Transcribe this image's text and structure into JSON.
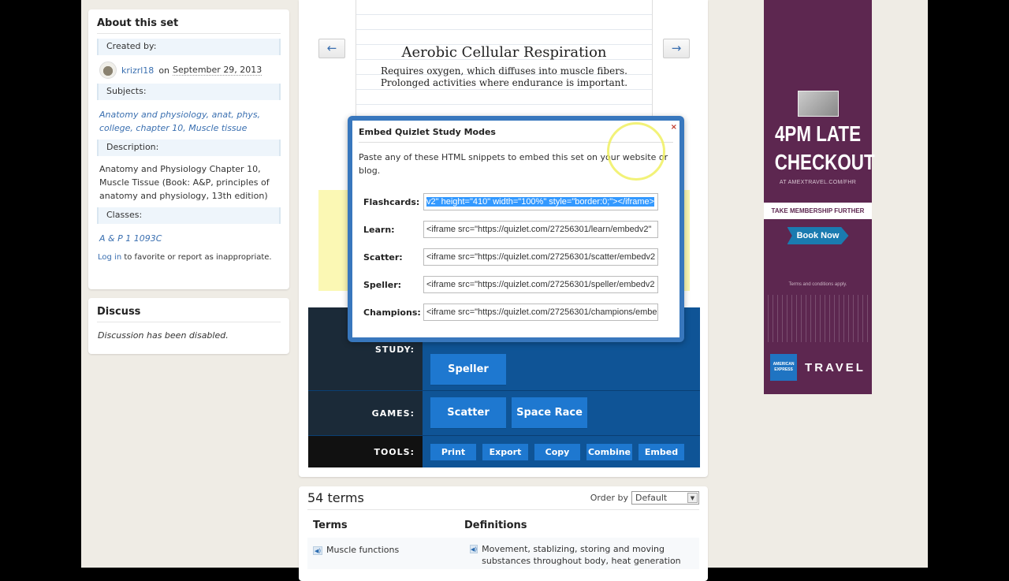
{
  "about": {
    "title": "About this set",
    "created_label": "Created by:",
    "author": "krizrl18",
    "on": "on",
    "date": "September 29, 2013",
    "subjects_label": "Subjects:",
    "subjects": [
      "Anatomy and physiology",
      "anat",
      "phys",
      "college",
      "chapter 10",
      "Muscle tissue"
    ],
    "description_label": "Description:",
    "description": "Anatomy and Physiology Chapter 10, Muscle Tissue (Book: A&P, principles of anatomy and physiology, 13th edition)",
    "classes_label": "Classes:",
    "class": "A & P 1 1093C",
    "login": "Log in",
    "login_rest": "to favorite or report as inappropriate."
  },
  "discuss": {
    "title": "Discuss",
    "text": "Discussion has been disabled."
  },
  "flashcard": {
    "term": "Aerobic Cellular Respiration",
    "definition_line1": "Requires oxygen, which diffuses into muscle fibers.",
    "definition_line2": "Prolonged activities where endurance is important.",
    "prev": "←",
    "next": "→"
  },
  "modes": {
    "study_label": "STUDY:",
    "study": [
      "Speller"
    ],
    "games_label": "GAMES:",
    "games": [
      "Scatter",
      "Space Race"
    ],
    "tools_label": "TOOLS:",
    "tools": [
      "Print",
      "Export",
      "Copy",
      "Combine",
      "Embed"
    ]
  },
  "terms": {
    "count": "54 terms",
    "order_label": "Order by",
    "order_value": "Default",
    "col_terms": "Terms",
    "col_defs": "Definitions",
    "rows": [
      {
        "term": "Muscle functions",
        "definition": "Movement, stablizing, storing and moving substances throughout body, heat generation"
      }
    ]
  },
  "modal": {
    "title": "Embed Quizlet Study Modes",
    "close": "×",
    "intro": "Paste any of these HTML snippets to embed this set on your website or blog.",
    "rows": [
      {
        "label": "Flashcards:",
        "value": "v2\" height=\"410\" width=\"100%\" style=\"border:0;\"></iframe>"
      },
      {
        "label": "Learn:",
        "value": "<iframe src=\"https://quizlet.com/27256301/learn/embedv2\""
      },
      {
        "label": "Scatter:",
        "value": "<iframe src=\"https://quizlet.com/27256301/scatter/embedv2"
      },
      {
        "label": "Speller:",
        "value": "<iframe src=\"https://quizlet.com/27256301/speller/embedv2"
      },
      {
        "label": "Champions:",
        "value": "<iframe src=\"https://quizlet.com/27256301/champions/embe"
      }
    ]
  },
  "ad": {
    "headline1": "4PM LATE",
    "headline2": "CHECKOUT",
    "url": "AT AMEXTRAVEL.COM/FHR",
    "strip": "TAKE MEMBERSHIP FURTHER",
    "cta": "Book Now",
    "terms": "Terms and conditions apply.",
    "logo": "AMERICAN EXPRESS",
    "brand": "TRAVEL"
  }
}
